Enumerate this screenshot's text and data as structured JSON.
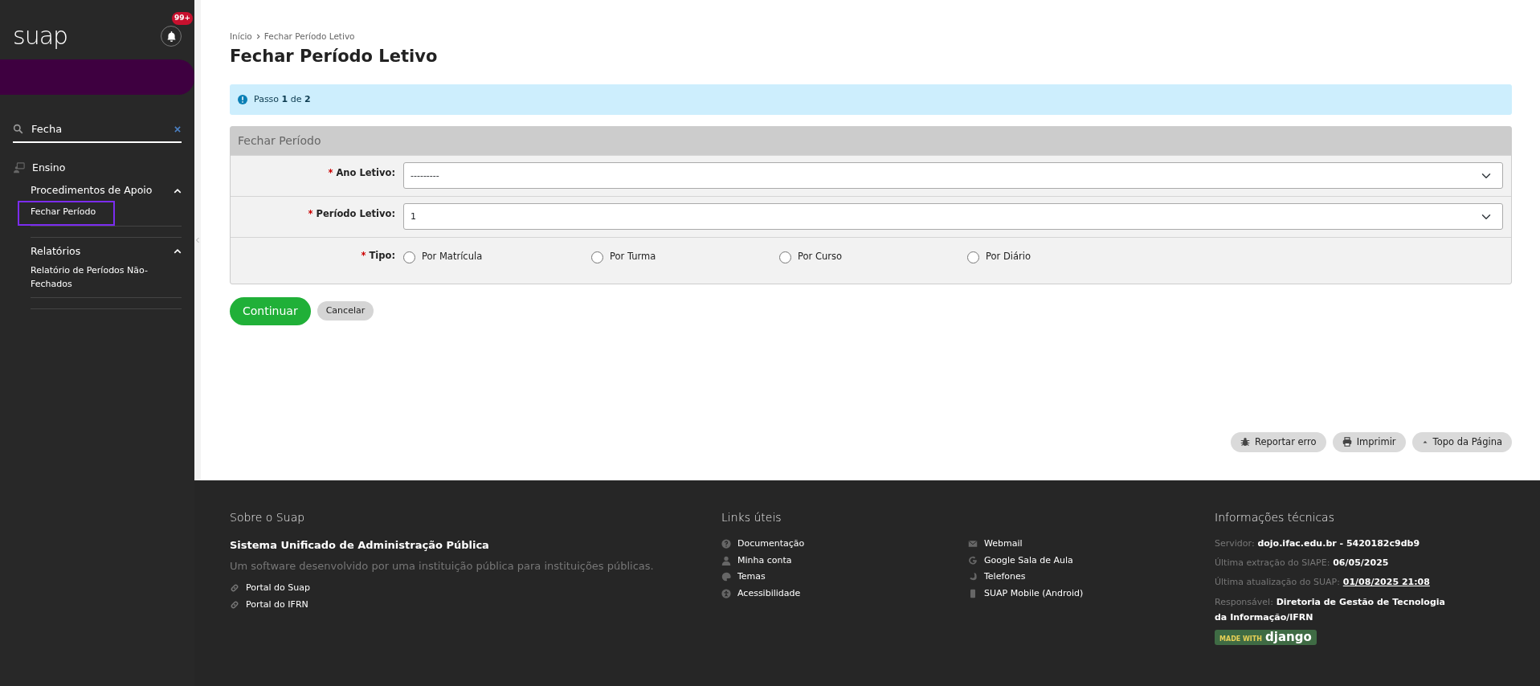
{
  "sidebar": {
    "logo": "suap",
    "notification_count": "99+",
    "search": {
      "value": "Fecha"
    },
    "menu": [
      {
        "label": "Ensino",
        "children": [
          {
            "label": "Procedimentos de Apoio",
            "expanded": true,
            "children": [
              {
                "label": "Fechar Período",
                "highlighted": true
              }
            ]
          },
          {
            "label": "Relatórios",
            "expanded": true,
            "children": [
              {
                "label": "Relatório de Períodos Não-Fechados",
                "highlighted": false
              }
            ]
          }
        ]
      }
    ]
  },
  "breadcrumb": [
    "Início",
    "Fechar Período Letivo"
  ],
  "title": "Fechar Período Letivo",
  "alert": "Passo **1** de **2**",
  "form": {
    "title": "Fechar Período",
    "fields": [
      {
        "kind": "select",
        "required_mark": "*",
        "label": "Ano Letivo:",
        "value": "---------"
      },
      {
        "kind": "select",
        "required_mark": "*",
        "label": "Período Letivo:",
        "value": "1"
      },
      {
        "kind": "radio",
        "required_mark": "*",
        "label": "Tipo:",
        "options": [
          {
            "label": "Por Matrícula",
            "selected": false
          },
          {
            "label": "Por Turma",
            "selected": false
          },
          {
            "label": "Por Curso",
            "selected": false
          },
          {
            "label": "Por Diário",
            "selected": false
          }
        ]
      }
    ]
  },
  "actions": [
    {
      "label": "Continuar",
      "kind": "primary"
    },
    {
      "label": "Cancelar",
      "kind": "secondary"
    }
  ],
  "page_tools": [
    "Reportar erro",
    "Imprimir",
    "Topo da Página"
  ],
  "footer": {
    "about": {
      "heading": "Sobre o Suap",
      "subtitle": "Sistema Unificado de Administração Pública",
      "description": "Um software desenvolvido por uma instituição pública para instituições públicas.",
      "links": [
        "Portal do Suap",
        "Portal do IFRN"
      ]
    },
    "useful_links": {
      "heading": "Links úteis",
      "columns": [
        [
          "Documentação",
          "Minha conta",
          "Temas",
          "Acessibilidade"
        ],
        [
          "Webmail",
          "Google Sala de Aula",
          "Telefones",
          "SUAP Mobile (Android)"
        ]
      ]
    },
    "technical": {
      "heading": "Informações técnicas",
      "rows": [
        {
          "label": "Servidor:",
          "value": "dojo.ifac.edu.br - 5420182c9db9",
          "link": false
        },
        {
          "label": "Última extração do SIAPE:",
          "value": "06/05/2025",
          "link": false
        },
        {
          "label": "Última atualização do SUAP:",
          "value": "01/08/2025 21:08",
          "link": true
        },
        {
          "label": "Responsável:",
          "value": "Diretoria de Gestão de Tecnologia da Informação/IFRN",
          "link": false
        }
      ],
      "badge": {
        "prefix": "MADE WITH",
        "name": "django"
      }
    }
  }
}
